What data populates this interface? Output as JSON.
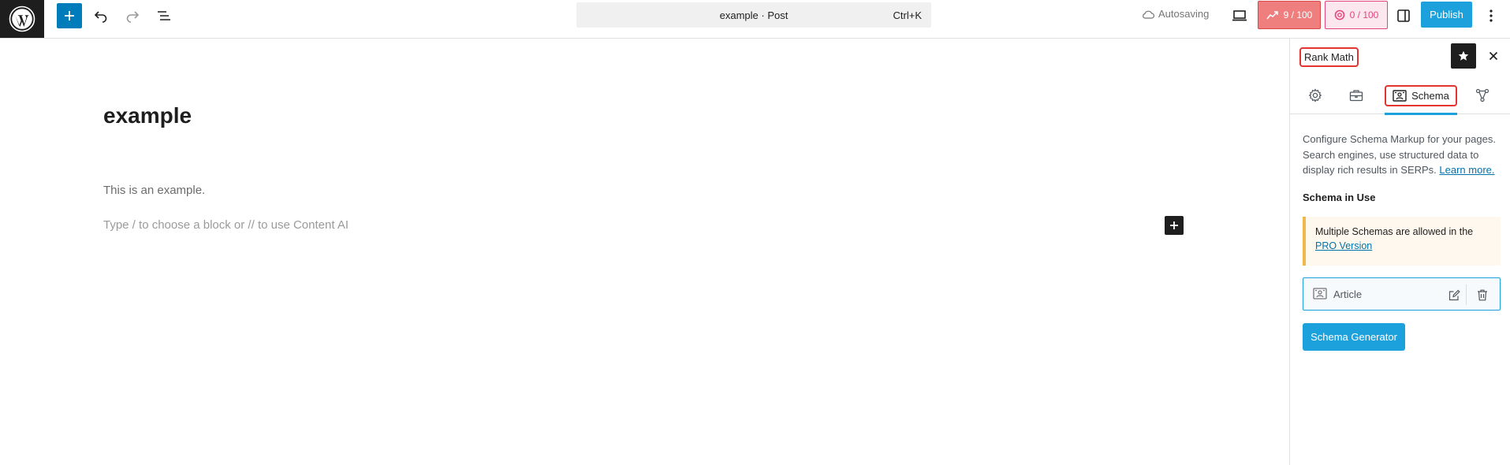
{
  "toolbar": {
    "command_bar_label": "example · Post",
    "command_bar_shortcut": "Ctrl+K",
    "autosave_label": "Autosaving",
    "seo_score": "9 / 100",
    "content_ai_score": "0 / 100",
    "publish_label": "Publish"
  },
  "editor": {
    "title": "example",
    "paragraph": "This is an example.",
    "placeholder": "Type / to choose a block or // to use Content AI"
  },
  "sidebar": {
    "title": "Rank Math",
    "tabs": [
      {
        "name": "general",
        "icon": "gear-icon",
        "label": ""
      },
      {
        "name": "advanced",
        "icon": "briefcase-icon",
        "label": ""
      },
      {
        "name": "schema",
        "icon": "schema-icon",
        "label": "Schema",
        "active": true
      },
      {
        "name": "social",
        "icon": "share-icon",
        "label": ""
      }
    ],
    "description": "Configure Schema Markup for your pages. Search engines, use structured data to display rich results in SERPs.",
    "learn_more": "Learn more.",
    "schema_heading": "Schema in Use",
    "notice_text": "Multiple Schemas are allowed in the",
    "notice_link": "PRO Version",
    "schema_item_label": "Article",
    "generator_button": "Schema Generator"
  },
  "colors": {
    "accent": "#1da1dc",
    "wp_blue": "#007cba",
    "seo_score_bg": "#ef7f7f",
    "content_ai": "#e3467d",
    "highlight": "#e3342f"
  }
}
